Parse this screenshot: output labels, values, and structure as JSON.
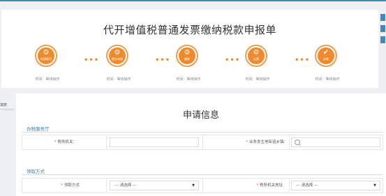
{
  "page_title": "代开增值税普通发票缴纳税款申报单",
  "steps": [
    {
      "caption": "申请填写",
      "glyph": "⚙",
      "time": "时间：等待操作"
    },
    {
      "caption": "提交审核",
      "glyph": "⚙",
      "time": "时间：等待操作"
    },
    {
      "caption": "缴款",
      "glyph": "⚙",
      "time": "时间：等待操作"
    },
    {
      "caption": "出票",
      "glyph": "⚙",
      "time": "时间：等待操作"
    },
    {
      "caption": "办结",
      "glyph": "✔",
      "time": "时间：等待操作"
    }
  ],
  "step_connector": "•••",
  "left_tab_label": "填表",
  "section_title": "申请信息",
  "group_service_hall": {
    "label": "办税服务厅",
    "tax_authority_label": "税务机关：",
    "tax_authority_value": "",
    "street_label": "业务发生地街道乡镇：",
    "street_value": ""
  },
  "group_pickup": {
    "label": "领取方式",
    "pickup_method_label": "领取方式",
    "pickup_method_value": "--- 请选择 ---",
    "tax_office_address_label": "税务机关地址",
    "tax_office_address_value": "--- 请选择 ---"
  },
  "colors": {
    "accent": "#f08a2c",
    "brand_blue": "#3c8dbc",
    "required": "#e0413e"
  }
}
